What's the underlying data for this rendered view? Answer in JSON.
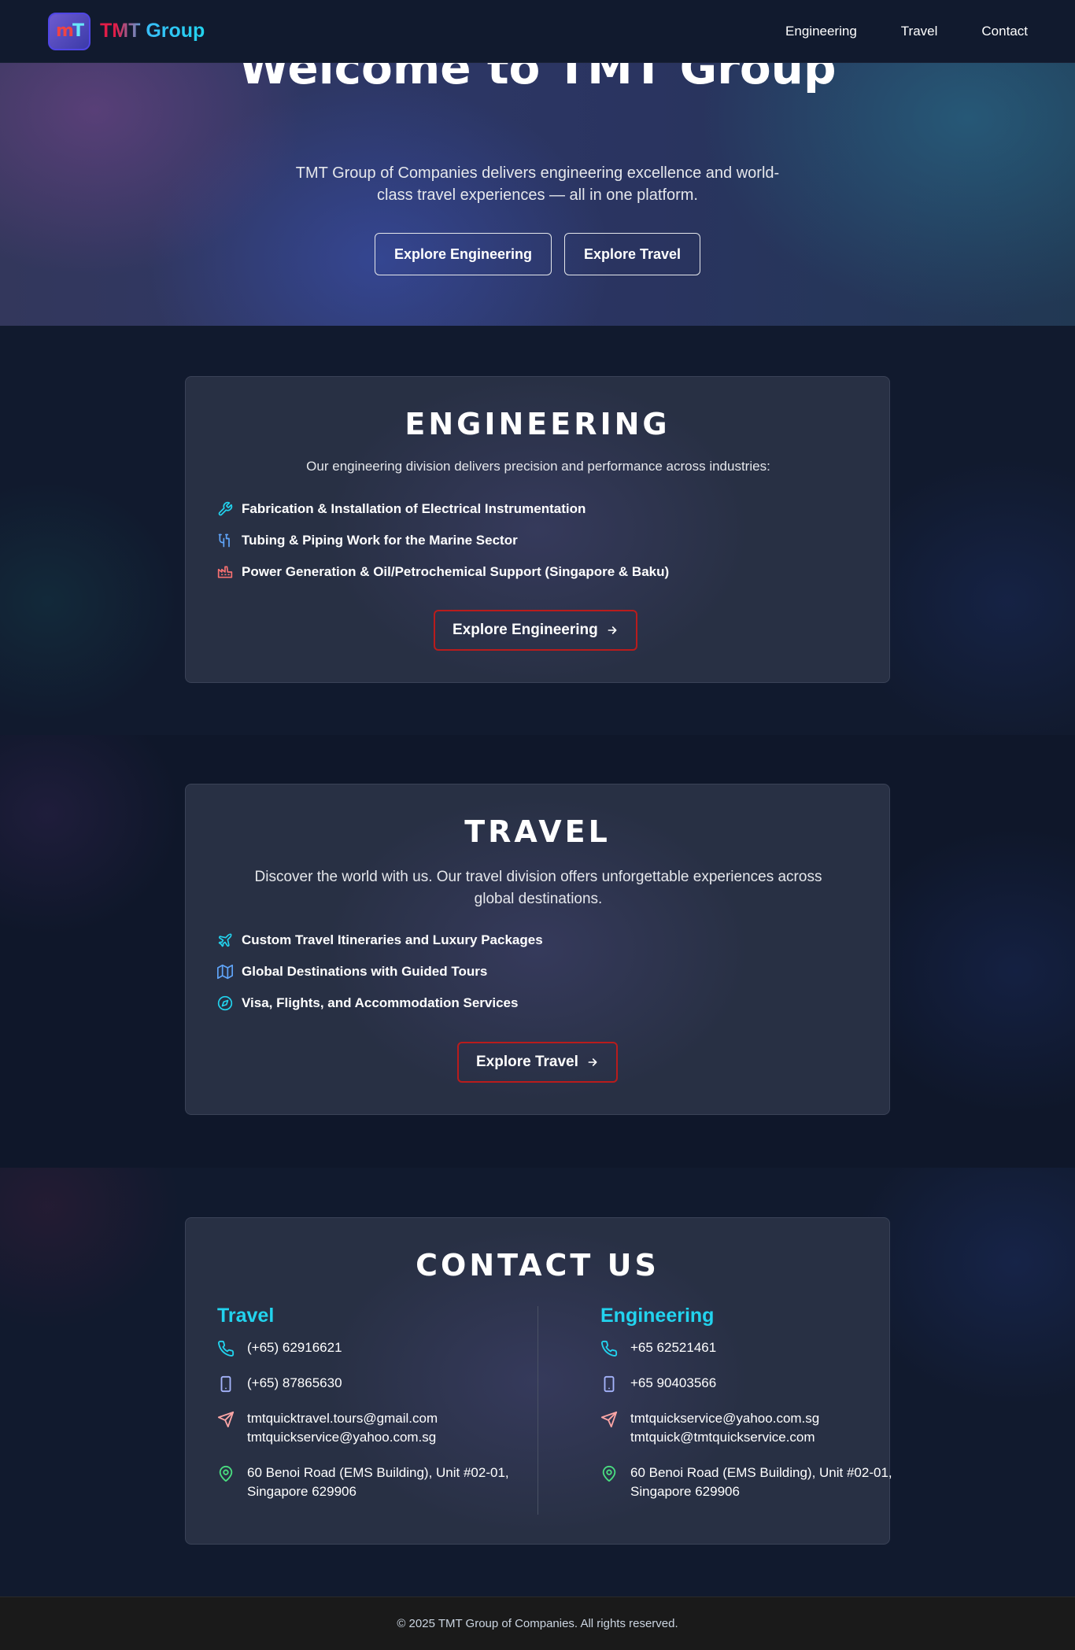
{
  "nav": {
    "logo_text": "TMT",
    "brand": "TMT Group",
    "links": [
      "Engineering",
      "Travel",
      "Contact"
    ]
  },
  "hero": {
    "title": "Welcome to TMT Group",
    "subtitle": "TMT Group of Companies delivers engineering excellence and world-class travel experiences — all in one platform.",
    "buttons": [
      "Explore Engineering",
      "Explore Travel"
    ]
  },
  "engineering": {
    "title": "ENGINEERING",
    "description": "Our engineering division delivers precision and performance across industries:",
    "items": [
      {
        "icon": "wrench-icon",
        "text": "Fabrication & Installation of Electrical Instrumentation"
      },
      {
        "icon": "pipe-icon",
        "text": "Tubing & Piping Work for the Marine Sector"
      },
      {
        "icon": "factory-icon",
        "text": "Power Generation & Oil/Petrochemical Support (Singapore & Baku)"
      }
    ],
    "button": "Explore Engineering"
  },
  "travel": {
    "title": "TRAVEL",
    "description": "Discover the world with us. Our travel division offers unforgettable experiences across global destinations.",
    "items": [
      {
        "icon": "plane-icon",
        "text": "Custom Travel Itineraries and Luxury Packages"
      },
      {
        "icon": "map-icon",
        "text": "Global Destinations with Guided Tours"
      },
      {
        "icon": "compass-icon",
        "text": "Visa, Flights, and Accommodation Services"
      }
    ],
    "button": "Explore Travel"
  },
  "contact": {
    "title": "CONTACT US",
    "travel": {
      "heading": "Travel",
      "phone": "(+65) 62916621",
      "mobile": "(+65) 87865630",
      "email1": "tmtquicktravel.tours@gmail.com",
      "email2": "tmtquickservice@yahoo.com.sg",
      "address": "60 Benoi Road (EMS Building), Unit #02-01, Singapore 629906"
    },
    "engineering": {
      "heading": "Engineering",
      "phone": "+65 62521461",
      "mobile": "+65 90403566",
      "email1": "tmtquickservice@yahoo.com.sg",
      "email2": "tmtquick@tmtquickservice.com",
      "address": "60 Benoi Road (EMS Building), Unit #02-01, Singapore 629906"
    }
  },
  "footer": {
    "copyright": "© 2025 TMT Group of Companies. All rights reserved."
  },
  "colors": {
    "accent_cyan": "#22d3ee",
    "accent_red": "#b91c1c",
    "background": "#0f172a",
    "card": "#283044"
  }
}
